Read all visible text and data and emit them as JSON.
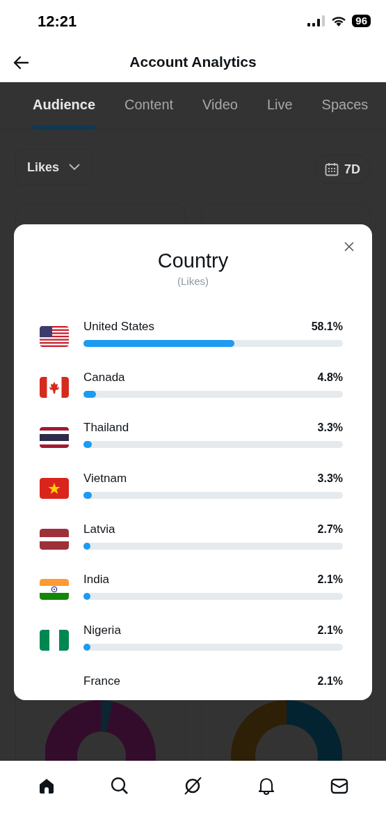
{
  "status_bar": {
    "time": "12:21",
    "battery": "96"
  },
  "header": {
    "title": "Account Analytics"
  },
  "tabs": [
    {
      "label": "Audience",
      "selected": true
    },
    {
      "label": "Content",
      "selected": false
    },
    {
      "label": "Video",
      "selected": false
    },
    {
      "label": "Live",
      "selected": false
    },
    {
      "label": "Spaces",
      "selected": false
    }
  ],
  "filters": {
    "metric": "Likes",
    "range": "7D"
  },
  "modal": {
    "title": "Country",
    "subtitle": "(Likes)",
    "rows": [
      {
        "kind": "usa",
        "name": "United States",
        "value": "58.1%",
        "level": 0.581
      },
      {
        "kind": "canada",
        "name": "Canada",
        "value": "4.8%",
        "level": 0.048
      },
      {
        "kind": "thailand",
        "name": "Thailand",
        "value": "3.3%",
        "level": 0.033
      },
      {
        "kind": "vietnam",
        "name": "Vietnam",
        "value": "3.3%",
        "level": 0.033
      },
      {
        "kind": "latvia",
        "name": "Latvia",
        "value": "2.7%",
        "level": 0.027
      },
      {
        "kind": "india",
        "name": "India",
        "value": "2.1%",
        "level": 0.021
      },
      {
        "kind": "nigeria",
        "name": "Nigeria",
        "value": "2.1%",
        "level": 0.021
      },
      {
        "name": "France",
        "value": "2.1%"
      }
    ]
  },
  "bottom_nav": [
    {
      "kind": "home"
    },
    {
      "kind": "search"
    },
    {
      "kind": "grok"
    },
    {
      "kind": "notifications"
    },
    {
      "kind": "messages"
    }
  ]
}
